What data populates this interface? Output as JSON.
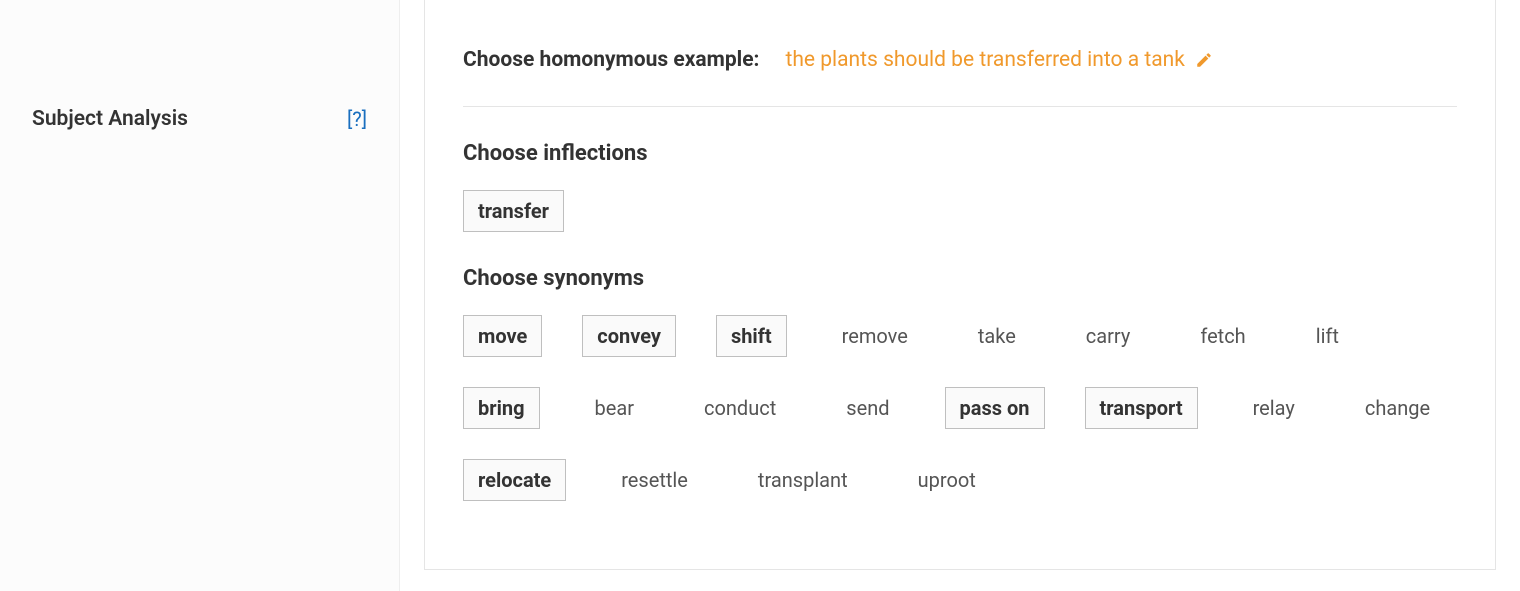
{
  "sidebar": {
    "item_label": "Subject Analysis",
    "help_label": "[?]"
  },
  "example": {
    "label": "Choose homonymous example:",
    "value": "the plants should be transferred into a tank"
  },
  "inflections": {
    "heading": "Choose inflections",
    "items": [
      {
        "text": "transfer",
        "selected": true
      }
    ]
  },
  "synonyms": {
    "heading": "Choose synonyms",
    "items": [
      {
        "text": "move",
        "selected": true
      },
      {
        "text": "convey",
        "selected": true
      },
      {
        "text": "shift",
        "selected": true
      },
      {
        "text": "remove",
        "selected": false
      },
      {
        "text": "take",
        "selected": false
      },
      {
        "text": "carry",
        "selected": false
      },
      {
        "text": "fetch",
        "selected": false
      },
      {
        "text": "lift",
        "selected": false
      },
      {
        "text": "bring",
        "selected": true
      },
      {
        "text": "bear",
        "selected": false
      },
      {
        "text": "conduct",
        "selected": false
      },
      {
        "text": "send",
        "selected": false
      },
      {
        "text": "pass on",
        "selected": true
      },
      {
        "text": "transport",
        "selected": true
      },
      {
        "text": "relay",
        "selected": false
      },
      {
        "text": "change",
        "selected": false
      },
      {
        "text": "relocate",
        "selected": true
      },
      {
        "text": "resettle",
        "selected": false
      },
      {
        "text": "transplant",
        "selected": false
      },
      {
        "text": "uproot",
        "selected": false
      }
    ]
  }
}
